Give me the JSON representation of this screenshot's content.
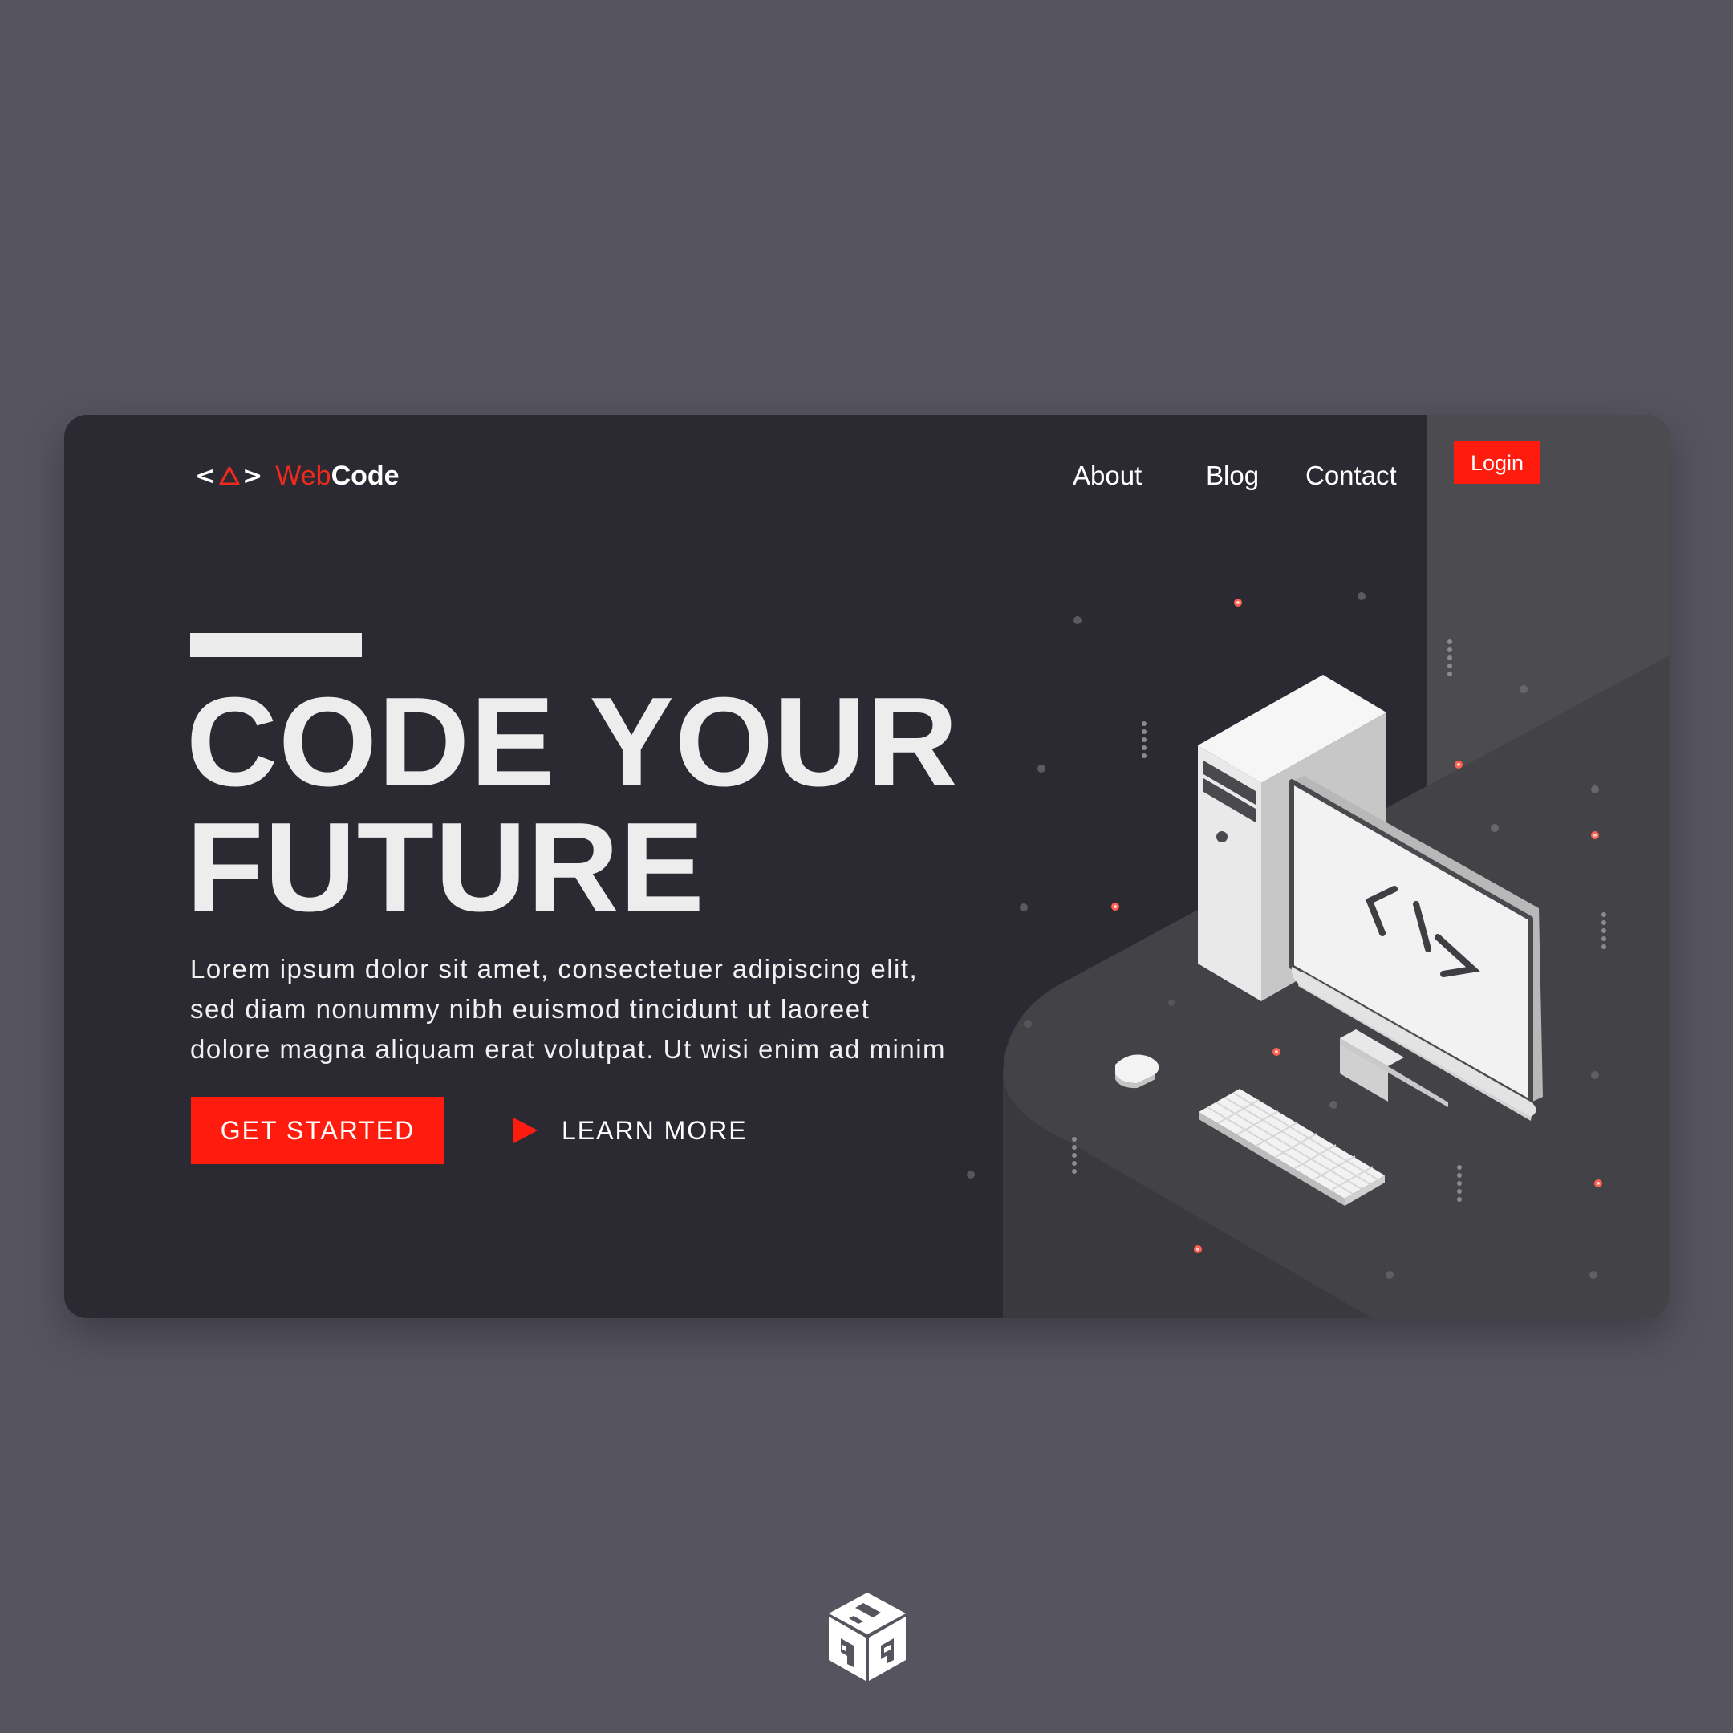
{
  "brand": {
    "mark_left": "<",
    "mark_right": ">",
    "name_part1": "Web",
    "name_part2": "Code"
  },
  "nav": {
    "items": [
      {
        "label": "About"
      },
      {
        "label": "Blog"
      },
      {
        "label": "Contact"
      }
    ],
    "login_label": "Login"
  },
  "hero": {
    "headline_line1": "CODE YOUR",
    "headline_line2": "FUTURE",
    "description_lines": [
      "Lorem ipsum dolor sit amet, consectetuer adipiscing elit,",
      "sed diam nonummy nibh euismod tincidunt ut laoreet",
      "dolore magna aliquam erat volutpat. Ut wisi enim ad minim"
    ],
    "primary_cta": "GET STARTED",
    "secondary_cta": "LEARN MORE"
  },
  "illustration": {
    "screen_symbol": "</>"
  },
  "watermark": {
    "letters": "SAA"
  },
  "colors": {
    "page_background": "#56555f",
    "card_background": "#2b2a33",
    "accent": "#ff1c0f",
    "text_primary": "#ffffff",
    "panel_gray": "#4b4b4f"
  },
  "icons": [
    "code-brackets-icon",
    "play-triangle-icon",
    "computer-tower-icon",
    "monitor-icon",
    "keyboard-icon",
    "mouse-icon",
    "cube-logo-icon"
  ]
}
